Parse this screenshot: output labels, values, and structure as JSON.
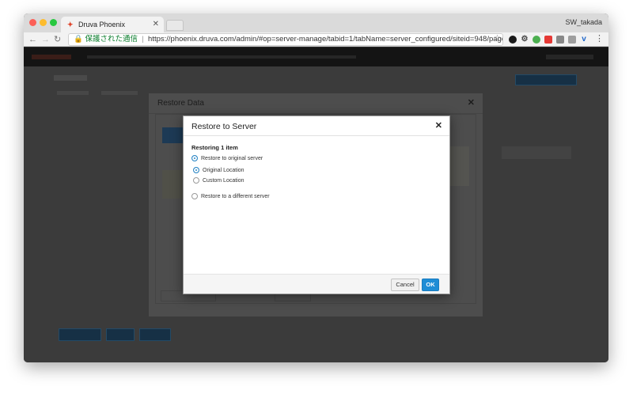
{
  "browser": {
    "tab_title": "Druva Phoenix",
    "profile_name": "SW_takada",
    "secure_label": "保護された通信",
    "url": "https://phoenix.druva.com/admin/#op=server-manage/tabid=1/tabName=server_configured/siteid=948/page=1/pageSize=2..."
  },
  "background_dialog": {
    "title": "Restore Data"
  },
  "modal": {
    "title": "Restore to Server",
    "subtitle": "Restoring 1 item",
    "options": [
      {
        "label": "Restore to original server",
        "selected": true
      },
      {
        "label": "Original Location",
        "selected": true
      },
      {
        "label": "Custom Location",
        "selected": false
      },
      {
        "label": "Restore to a different server",
        "selected": false
      }
    ],
    "cancel_label": "Cancel",
    "ok_label": "OK"
  },
  "colors": {
    "accent": "#1f8dd6",
    "brand": "#e0452b"
  }
}
